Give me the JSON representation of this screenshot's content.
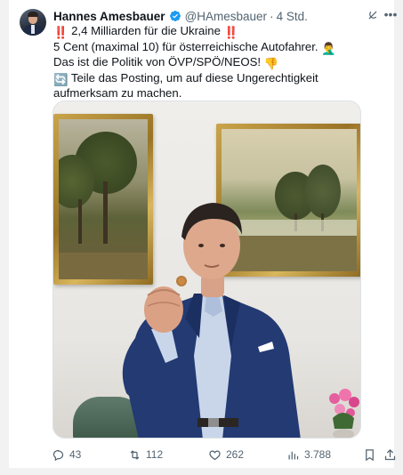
{
  "post": {
    "author_name": "Hannes Amesbauer",
    "handle": "@HAmesbauer",
    "separator": "·",
    "time": "4 Std.",
    "verified": true,
    "text_lines": [
      {
        "prefix_emoji": "‼️",
        "text": " 2,4 Milliarden für die Ukraine ",
        "suffix_emoji": "‼️"
      },
      {
        "prefix_emoji": "",
        "text": "5 Cent (maximal 10) für österreichische Autofahrer. ",
        "suffix_emoji": "🤦‍♂️"
      },
      {
        "prefix_emoji": "",
        "text": "Das ist die Politik von ÖVP/SPÖ/NEOS! ",
        "suffix_emoji": "👎"
      },
      {
        "prefix_emoji": "🔄",
        "text": " Teile das Posting, um auf diese Ungerechtigkeit aufmerksam zu machen.",
        "suffix_emoji": ""
      }
    ]
  },
  "actions": {
    "replies": "43",
    "reposts": "112",
    "likes": "262",
    "views": "3.788"
  },
  "icons": {
    "reply": "reply-icon",
    "repost": "repost-icon",
    "like": "heart-icon",
    "views": "views-icon",
    "bookmark": "bookmark-icon",
    "share": "share-icon",
    "grok": "grok-icon",
    "more": "more-icon",
    "verified": "verified-badge-icon"
  },
  "colors": {
    "text": "#0f1419",
    "muted": "#536471",
    "verified": "#1d9bf0",
    "emoji_red": "#e0245e"
  }
}
